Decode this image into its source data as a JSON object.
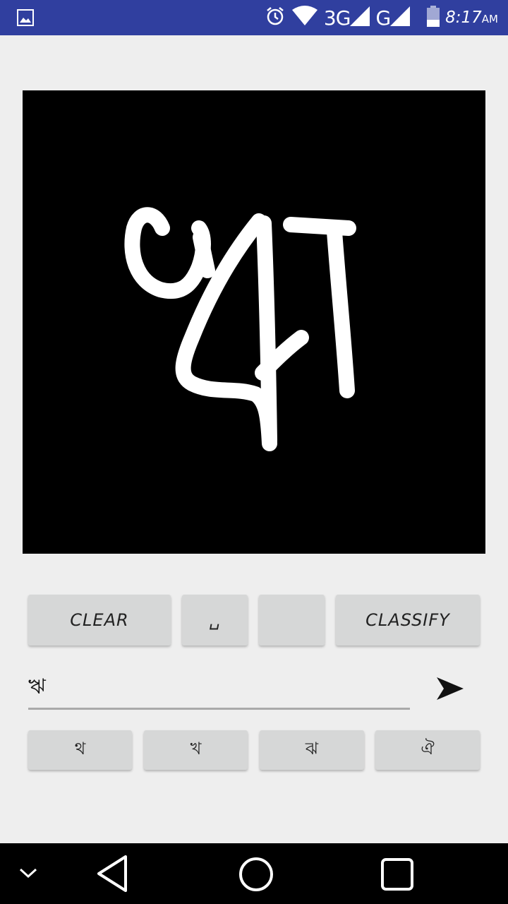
{
  "status_bar": {
    "network_1": "3G",
    "network_2": "G",
    "time": "8:17",
    "am_pm": "AM",
    "icons": [
      "image-icon",
      "alarm-icon",
      "wifi-icon",
      "signal-icon",
      "battery-icon"
    ]
  },
  "drawing_canvas": {
    "background_color": "#000000",
    "stroke_color": "#ffffff"
  },
  "buttons": {
    "clear_label": "CLEAR",
    "space_label": "␣",
    "blank_label": "",
    "classify_label": "CLASSIFY"
  },
  "input": {
    "value": "ঋ"
  },
  "suggestions": [
    "থ",
    "খ",
    "ঝ",
    "ঐ"
  ],
  "colors": {
    "status_bar": "#303f9f",
    "button_bg": "#d6d7d7",
    "page_bg": "#eeeeee"
  }
}
